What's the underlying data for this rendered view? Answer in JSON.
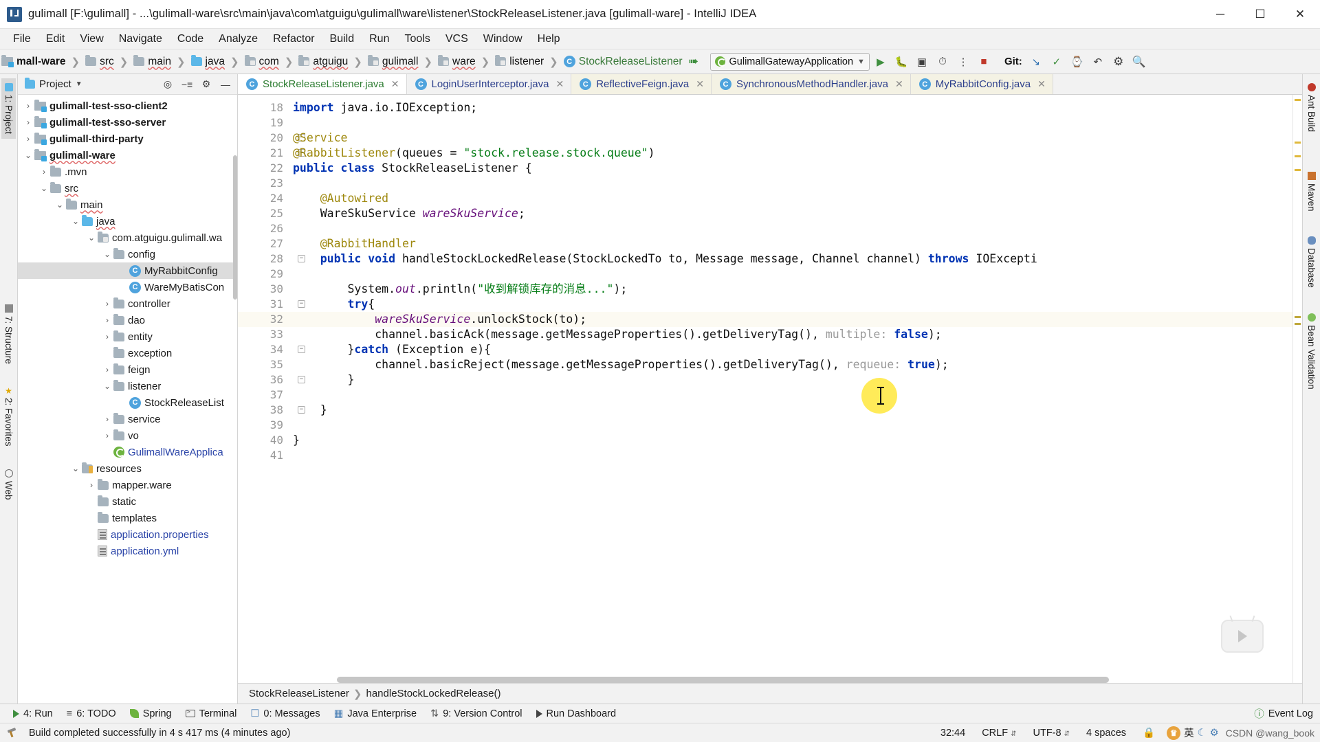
{
  "window": {
    "title": "gulimall [F:\\gulimall] - ...\\gulimall-ware\\src\\main\\java\\com\\atguigu\\gulimall\\ware\\listener\\StockReleaseListener.java [gulimall-ware] - IntelliJ IDEA",
    "minimize": "─",
    "maximize": "☐",
    "close": "✕"
  },
  "menu": {
    "items": [
      "File",
      "Edit",
      "View",
      "Navigate",
      "Code",
      "Analyze",
      "Refactor",
      "Build",
      "Run",
      "Tools",
      "VCS",
      "Window",
      "Help"
    ]
  },
  "navbar": {
    "breadcrumbs": [
      {
        "label": "mall-ware",
        "icon": "module-icon",
        "bold": true
      },
      {
        "label": "src",
        "icon": "folder-icon"
      },
      {
        "label": "main",
        "icon": "folder-icon"
      },
      {
        "label": "java",
        "icon": "folder-blue-icon"
      },
      {
        "label": "com",
        "icon": "package-icon"
      },
      {
        "label": "atguigu",
        "icon": "package-icon"
      },
      {
        "label": "gulimall",
        "icon": "package-icon"
      },
      {
        "label": "ware",
        "icon": "package-icon"
      },
      {
        "label": "listener",
        "icon": "package-icon"
      },
      {
        "label": "StockReleaseListener",
        "icon": "class-icon"
      }
    ],
    "run_config": "GulimallGatewayApplication",
    "git_label": "Git:",
    "toolbar_icons": [
      "build-icon",
      "run-icon",
      "debug-icon",
      "run-coverage-icon",
      "profile-icon",
      "search-everywhere-icon",
      "stop-icon",
      "git-update-icon",
      "git-commit-icon",
      "git-push-icon",
      "history-icon",
      "undo-icon",
      "settings-icon",
      "search-icon"
    ]
  },
  "project_panel": {
    "title": "Project",
    "header_buttons": [
      "locate-icon",
      "collapse-all-icon",
      "settings-icon",
      "hide-icon"
    ],
    "tree": [
      {
        "indent": 1,
        "arrow": "›",
        "icon": "module-icon",
        "label": "gulimall-test-sso-client2",
        "bold": true
      },
      {
        "indent": 1,
        "arrow": "›",
        "icon": "module-icon",
        "label": "gulimall-test-sso-server",
        "bold": true
      },
      {
        "indent": 1,
        "arrow": "›",
        "icon": "module-icon",
        "label": "gulimall-third-party",
        "bold": true
      },
      {
        "indent": 1,
        "arrow": "⌄",
        "icon": "module-icon",
        "label": "gulimall-ware",
        "bold": true,
        "squiggle": true
      },
      {
        "indent": 2,
        "arrow": "›",
        "icon": "folder-icon",
        "label": ".mvn"
      },
      {
        "indent": 2,
        "arrow": "⌄",
        "icon": "folder-icon",
        "label": "src",
        "squiggle": true
      },
      {
        "indent": 3,
        "arrow": "⌄",
        "icon": "folder-icon",
        "label": "main",
        "squiggle": true
      },
      {
        "indent": 4,
        "arrow": "⌄",
        "icon": "folder-blue-icon",
        "label": "java",
        "squiggle": true
      },
      {
        "indent": 5,
        "arrow": "⌄",
        "icon": "package-icon",
        "label": "com.atguigu.gulimall.wa"
      },
      {
        "indent": 6,
        "arrow": "⌄",
        "icon": "folder-icon",
        "label": "config"
      },
      {
        "indent": 7,
        "arrow": "",
        "icon": "class-icon",
        "label": "MyRabbitConfig",
        "selected": true
      },
      {
        "indent": 7,
        "arrow": "",
        "icon": "class-icon",
        "label": "WareMyBatisCon"
      },
      {
        "indent": 6,
        "arrow": "›",
        "icon": "folder-icon",
        "label": "controller"
      },
      {
        "indent": 6,
        "arrow": "›",
        "icon": "folder-icon",
        "label": "dao"
      },
      {
        "indent": 6,
        "arrow": "›",
        "icon": "folder-icon",
        "label": "entity"
      },
      {
        "indent": 6,
        "arrow": "",
        "icon": "folder-icon",
        "label": "exception"
      },
      {
        "indent": 6,
        "arrow": "›",
        "icon": "folder-icon",
        "label": "feign"
      },
      {
        "indent": 6,
        "arrow": "⌄",
        "icon": "folder-icon",
        "label": "listener"
      },
      {
        "indent": 7,
        "arrow": "",
        "icon": "class-icon",
        "label": "StockReleaseList"
      },
      {
        "indent": 6,
        "arrow": "›",
        "icon": "folder-icon",
        "label": "service"
      },
      {
        "indent": 6,
        "arrow": "›",
        "icon": "folder-icon",
        "label": "vo"
      },
      {
        "indent": 6,
        "arrow": "",
        "icon": "spring-class-icon",
        "label": "GulimallWareApplica",
        "link": true
      },
      {
        "indent": 4,
        "arrow": "⌄",
        "icon": "resources-icon",
        "label": "resources"
      },
      {
        "indent": 5,
        "arrow": "›",
        "icon": "folder-icon",
        "label": "mapper.ware"
      },
      {
        "indent": 5,
        "arrow": "",
        "icon": "folder-icon",
        "label": "static"
      },
      {
        "indent": 5,
        "arrow": "",
        "icon": "folder-icon",
        "label": "templates"
      },
      {
        "indent": 5,
        "arrow": "",
        "icon": "properties-icon",
        "label": "application.properties",
        "link": true
      },
      {
        "indent": 5,
        "arrow": "",
        "icon": "properties-icon",
        "label": "application.yml",
        "link": true
      }
    ]
  },
  "left_strip": [
    {
      "label": "1: Project",
      "icon": "project-icon",
      "active": true
    },
    {
      "label": "7: Structure",
      "icon": "structure-icon"
    },
    {
      "label": "2: Favorites",
      "icon": "star-icon"
    },
    {
      "label": "Web",
      "icon": "web-icon"
    }
  ],
  "right_strip": [
    {
      "label": "Ant Build",
      "icon": "ant-icon"
    },
    {
      "label": "Maven",
      "icon": "maven-icon"
    },
    {
      "label": "Database",
      "icon": "database-icon"
    },
    {
      "label": "Bean Validation",
      "icon": "bean-icon"
    }
  ],
  "editor": {
    "tabs": [
      {
        "label": "StockReleaseListener.java",
        "icon": "class-icon",
        "active": true
      },
      {
        "label": "LoginUserInterceptor.java",
        "icon": "class-icon"
      },
      {
        "label": "ReflectiveFeign.java",
        "icon": "class-icon"
      },
      {
        "label": "SynchronousMethodHandler.java",
        "icon": "class-icon"
      },
      {
        "label": "MyRabbitConfig.java",
        "icon": "class-icon"
      }
    ],
    "first_line_number": 18,
    "highlighted_line": 32,
    "lines": [
      {
        "n": 18,
        "html": "<span class=\"kw\">import</span> java.io.IOException;"
      },
      {
        "n": 19,
        "html": ""
      },
      {
        "n": 20,
        "html": "<span class=\"anno\">@Service</span>",
        "gutter_icon": "bean-icon",
        "fold": true
      },
      {
        "n": 21,
        "html": "<span class=\"anno\">@RabbitListener</span>(queues = <span class=\"str\">\"stock.release.stock.queue\"</span>)",
        "fold": true
      },
      {
        "n": 22,
        "html": "<span class=\"kw\">public class</span> StockReleaseListener {",
        "gutter_icon": "bean-icon"
      },
      {
        "n": 23,
        "html": ""
      },
      {
        "n": 24,
        "html": "    <span class=\"anno\">@Autowired</span>"
      },
      {
        "n": 25,
        "html": "    WareSkuService <span class=\"fld\">wareSkuService</span>;",
        "gutter_icon": "bean-icon"
      },
      {
        "n": 26,
        "html": ""
      },
      {
        "n": 27,
        "html": "    <span class=\"anno\">@RabbitHandler</span>"
      },
      {
        "n": 28,
        "html": "    <span class=\"kw\">public void</span> handleStockLockedRelease(StockLockedTo to, Message message, Channel channel) <span class=\"kw\">throws</span> IOExcepti",
        "fold": true
      },
      {
        "n": 29,
        "html": ""
      },
      {
        "n": 30,
        "html": "        System.<span class=\"stat\">out</span>.println(<span class=\"str\">\"收到解锁库存的消息...\"</span>);"
      },
      {
        "n": 31,
        "html": "        <span class=\"kw\">try</span>{",
        "fold": true
      },
      {
        "n": 32,
        "html": "            <span class=\"fld\">wareSkuService</span>.unlockStock(to);",
        "highlight": true
      },
      {
        "n": 33,
        "html": "            channel.basicAck(message.getMessageProperties().getDeliveryTag(), <span class=\"hint\">multiple:</span> <span class=\"kw\">false</span>);"
      },
      {
        "n": 34,
        "html": "        }<span class=\"kw\">catch</span> (Exception e){",
        "fold": true
      },
      {
        "n": 35,
        "html": "            channel.basicReject(message.getMessageProperties().getDeliveryTag(), <span class=\"hint\">requeue:</span> <span class=\"kw\">true</span>);"
      },
      {
        "n": 36,
        "html": "        }",
        "fold": true
      },
      {
        "n": 37,
        "html": ""
      },
      {
        "n": 38,
        "html": "    }",
        "fold": true
      },
      {
        "n": 39,
        "html": ""
      },
      {
        "n": 40,
        "html": "}"
      },
      {
        "n": 41,
        "html": ""
      }
    ],
    "bottom_breadcrumb": [
      "StockReleaseListener",
      "handleStockLockedRelease()"
    ]
  },
  "bottom_bar": {
    "items": [
      {
        "label": "4: Run",
        "icon": "run-icon"
      },
      {
        "label": "6: TODO",
        "icon": "todo-icon"
      },
      {
        "label": "Spring",
        "icon": "spring-icon"
      },
      {
        "label": "Terminal",
        "icon": "terminal-icon"
      },
      {
        "label": "0: Messages",
        "icon": "messages-icon"
      },
      {
        "label": "Java Enterprise",
        "icon": "java-ee-icon"
      },
      {
        "label": "9: Version Control",
        "icon": "version-control-icon"
      },
      {
        "label": "Run Dashboard",
        "icon": "dashboard-icon"
      }
    ],
    "event_log": "Event Log",
    "event_log_icon": "event-log-icon"
  },
  "status_bar": {
    "message": "Build completed successfully in 4 s 417 ms (4 minutes ago)",
    "message_icon": "build-icon",
    "caret_position": "32:44",
    "line_separator": "CRLF",
    "encoding": "UTF-8",
    "indent": "4 spaces",
    "ime": "英",
    "lock_icon": "lock-icon",
    "watermark": "CSDN @wang_book"
  },
  "colors": {
    "accent_blue": "#4fa3dd",
    "keyword": "#0033b3",
    "string": "#067d17",
    "annotation": "#9e880d",
    "field": "#660e7a",
    "highlight_line": "#fcfaf2",
    "cursor_blob": "#ffe100",
    "green_tab": "#2e7d32",
    "close_red": "#e81123"
  }
}
